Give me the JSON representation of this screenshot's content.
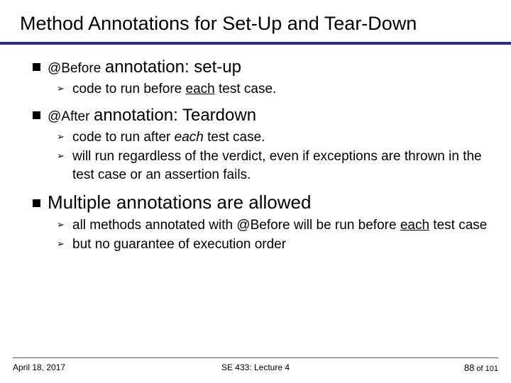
{
  "title": "Method Annotations for Set-Up and Tear-Down",
  "bullets": [
    {
      "code": "@Before",
      "ann": "annotation: set-up",
      "subs": [
        {
          "parts": [
            "code to run before ",
            {
              "ul": "each"
            },
            " test case."
          ]
        }
      ]
    },
    {
      "code": "@After",
      "ann": "annotation: Teardown",
      "subs": [
        {
          "parts": [
            "code to run after ",
            {
              "it": "each"
            },
            " test case."
          ]
        },
        {
          "parts": [
            "will run regardless of the verdict, even if exceptions are thrown in the test case or an assertion fails."
          ]
        }
      ]
    },
    {
      "bigger": "Multiple annotations are allowed",
      "subs": [
        {
          "parts": [
            "all methods annotated with @Before will be run before ",
            {
              "ul": "each"
            },
            " test case"
          ]
        },
        {
          "parts": [
            "but no guarantee of execution order"
          ]
        }
      ]
    }
  ],
  "footer": {
    "date": "April 18, 2017",
    "course": "SE 433: Lecture 4",
    "page_current": "88",
    "page_of": " of ",
    "page_total": "101"
  }
}
